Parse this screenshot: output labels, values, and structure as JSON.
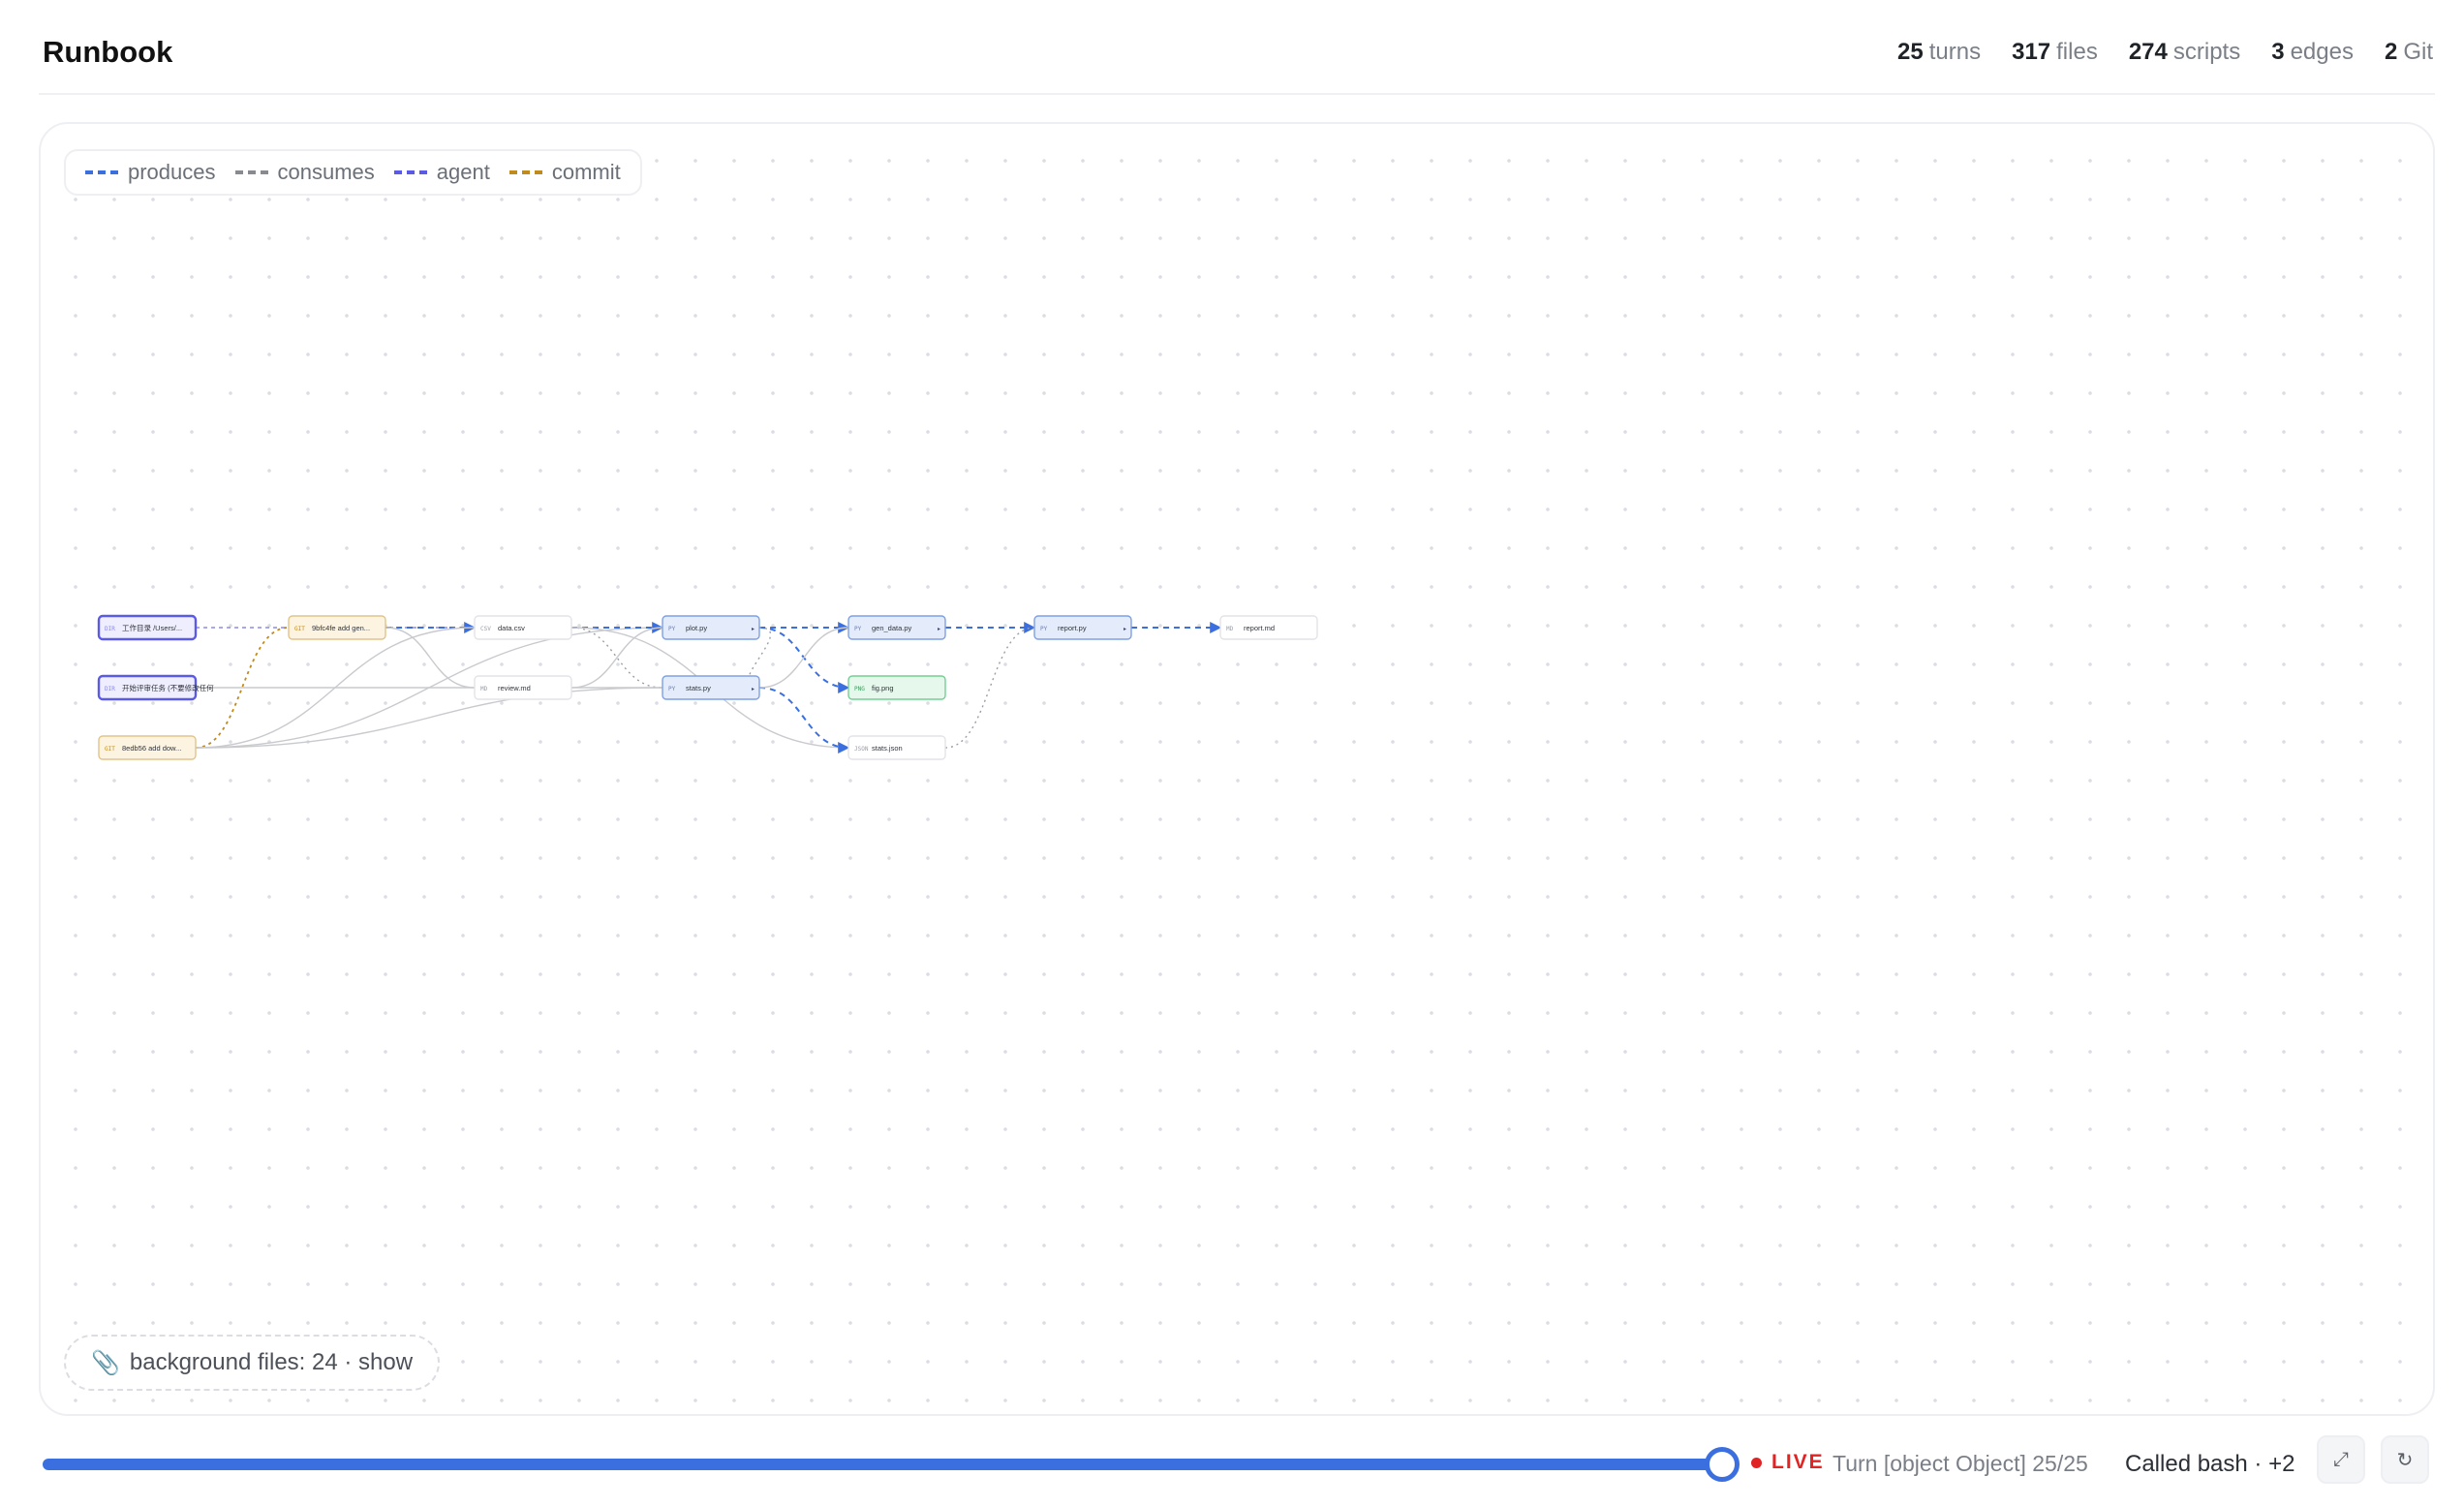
{
  "app": {
    "title": "Runbook"
  },
  "stats": [
    {
      "num": "25",
      "label": "turns"
    },
    {
      "num": "317",
      "label": "files"
    },
    {
      "num": "274",
      "label": "scripts"
    },
    {
      "num": "3",
      "label": "edges"
    },
    {
      "num": "2",
      "label": "Git"
    }
  ],
  "legend": [
    {
      "label": "produces",
      "color": "#3b6fe0"
    },
    {
      "label": "consumes",
      "color": "#888a90"
    },
    {
      "label": "agent",
      "color": "#5a5ae6"
    },
    {
      "label": "commit",
      "color": "#c08a1c"
    }
  ],
  "nodes": [
    {
      "id": "workdir",
      "kind": "DIR",
      "label": "工作目录 /Users/...",
      "type": "agent"
    },
    {
      "id": "task",
      "kind": "DIR",
      "label": "开始评审任务 (不要修改任何",
      "type": "agent"
    },
    {
      "id": "commit1",
      "kind": "GIT",
      "label": "9bfc4fe add gen...",
      "type": "commit"
    },
    {
      "id": "commit2",
      "kind": "GIT",
      "label": "8edb56 add dow...",
      "type": "commit"
    },
    {
      "id": "data_csv",
      "kind": "CSV",
      "label": "data.csv",
      "type": "file"
    },
    {
      "id": "review_md",
      "kind": "MD",
      "label": "review.md",
      "type": "file"
    },
    {
      "id": "plot_py",
      "kind": "PY",
      "label": "plot.py",
      "type": "script"
    },
    {
      "id": "stats_py",
      "kind": "PY",
      "label": "stats.py",
      "type": "script"
    },
    {
      "id": "gen_data_py",
      "kind": "PY",
      "label": "gen_data.py",
      "type": "script"
    },
    {
      "id": "fig_png",
      "kind": "PNG",
      "label": "fig.png",
      "type": "image"
    },
    {
      "id": "stats_json",
      "kind": "JSON",
      "label": "stats.json",
      "type": "file"
    },
    {
      "id": "report_py",
      "kind": "PY",
      "label": "report.py",
      "type": "script"
    },
    {
      "id": "report_md",
      "kind": "MD",
      "label": "report.md",
      "type": "file"
    }
  ],
  "background_files": {
    "text": "background files: 24 · show"
  },
  "timeline": {
    "progress": 1.0,
    "live_label": "LIVE",
    "turn_text": "Turn [object Object] 25/25",
    "called_text": "Called bash · +2",
    "expand_icon": "⤢",
    "reset_icon": "↻"
  }
}
